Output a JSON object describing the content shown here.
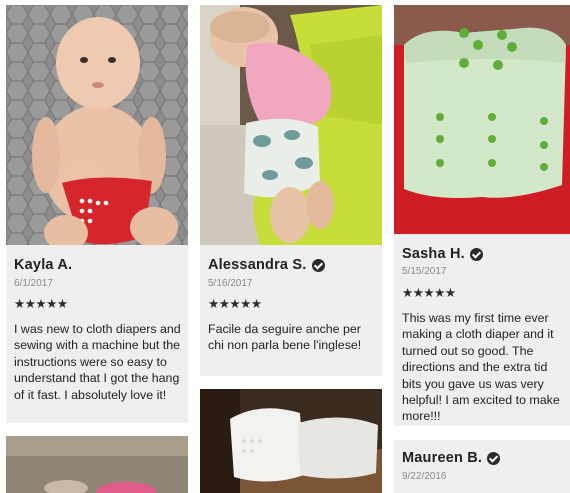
{
  "reviews": [
    {
      "name": "Kayla A.",
      "verified": false,
      "date": "6/1/2017",
      "rating": 5,
      "stars": "★★★★★",
      "text": "I was new to cloth diapers and sewing with a machine but the instructions were so easy to understand that I got the hang of it fast. I absolutely love it!"
    },
    {
      "name": "Alessandra S.",
      "verified": true,
      "date": "5/16/2017",
      "rating": 5,
      "stars": "★★★★★",
      "text": "Facile da seguire anche per chi non parla bene l'inglese!"
    },
    {
      "name": "Sasha H.",
      "verified": true,
      "date": "5/15/2017",
      "rating": 5,
      "stars": "★★★★★",
      "text": "This was my first time ever making a cloth diaper and it turned out so good. The directions and the extra tid bits you gave us was very helpful! I am excited to make more!!!"
    },
    {
      "name": "Maureen B.",
      "verified": true,
      "date": "9/22/2016",
      "rating": null,
      "stars": "",
      "text": ""
    }
  ],
  "colors": {
    "card_bg": "#efefef",
    "text": "#222222",
    "date": "#8a8a8a",
    "diaper_red": "#d7262b",
    "snap_green": "#6fae3e"
  },
  "icons": [
    "verified-check-icon",
    "star-icon"
  ]
}
